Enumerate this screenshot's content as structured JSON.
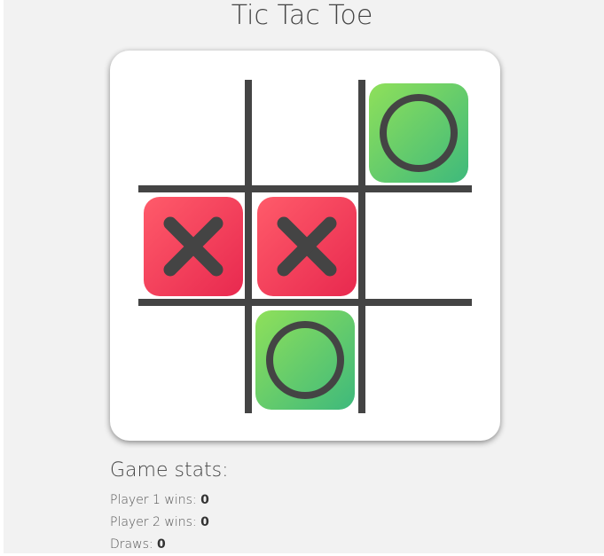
{
  "title": "Tic Tac Toe",
  "board": {
    "cells": [
      "",
      "",
      "O",
      "X",
      "X",
      "",
      "",
      "O",
      ""
    ]
  },
  "colors": {
    "x_tile_start": "#ff5b6a",
    "x_tile_end": "#e8294f",
    "o_tile_start": "#8fe05a",
    "o_tile_end": "#3eb97c",
    "mark": "#444444",
    "grid": "#444444"
  },
  "stats": {
    "title": "Game stats:",
    "player1_label": "Player 1 wins:",
    "player1_value": "0",
    "player2_label": "Player 2 wins:",
    "player2_value": "0",
    "draws_label": "Draws:",
    "draws_value": "0"
  }
}
